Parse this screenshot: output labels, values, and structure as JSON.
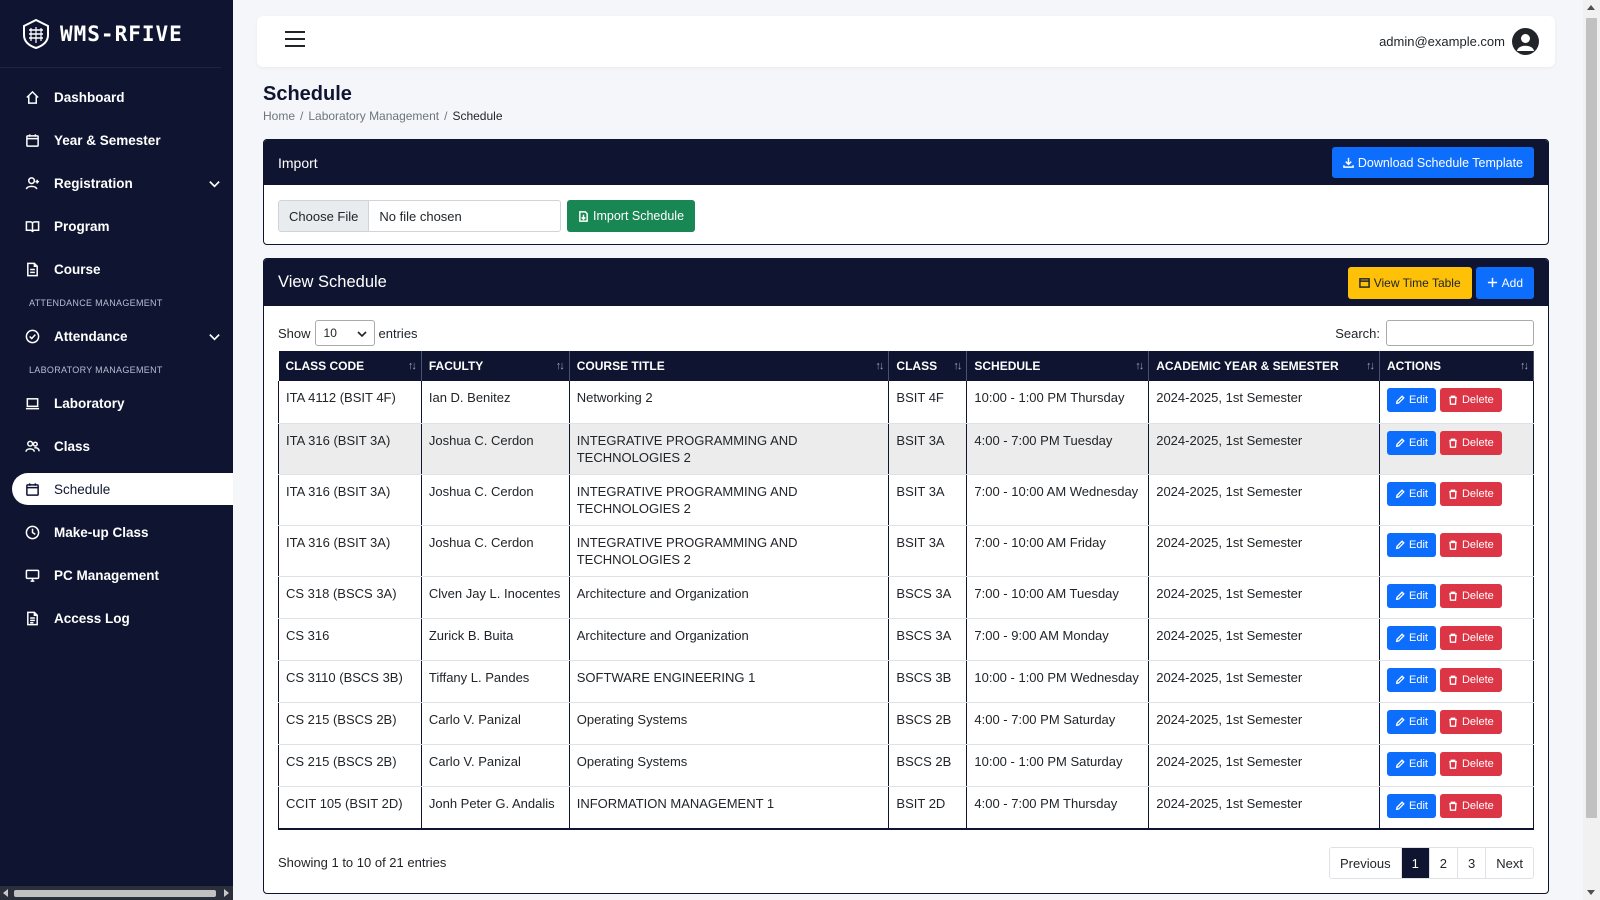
{
  "brand": {
    "name": "WMS-RFIVE"
  },
  "sidebar": {
    "items": [
      {
        "label": "Dashboard",
        "icon": "home-icon"
      },
      {
        "label": "Year & Semester",
        "icon": "calendar-icon"
      },
      {
        "label": "Registration",
        "icon": "user-plus-icon",
        "expandable": true
      },
      {
        "label": "Program",
        "icon": "book-open-icon"
      },
      {
        "label": "Course",
        "icon": "file-icon"
      }
    ],
    "section_attendance": "ATTENDANCE MANAGEMENT",
    "attendance_items": [
      {
        "label": "Attendance",
        "icon": "check-circle-icon",
        "expandable": true
      }
    ],
    "section_laboratory": "LABORATORY MANAGEMENT",
    "lab_items": [
      {
        "label": "Laboratory",
        "icon": "laptop-icon"
      },
      {
        "label": "Class",
        "icon": "users-icon"
      },
      {
        "label": "Schedule",
        "icon": "calendar-icon",
        "active": true
      },
      {
        "label": "Make-up Class",
        "icon": "clock-icon"
      },
      {
        "label": "PC Management",
        "icon": "monitor-icon"
      },
      {
        "label": "Access Log",
        "icon": "file-text-icon"
      }
    ]
  },
  "topbar": {
    "user_email": "admin@example.com"
  },
  "page": {
    "title": "Schedule",
    "breadcrumb": [
      "Home",
      "Laboratory Management",
      "Schedule"
    ]
  },
  "import_card": {
    "title": "Import",
    "download_label": "Download Schedule Template",
    "choose_label": "Choose File",
    "no_file": "No file chosen",
    "import_label": "Import Schedule"
  },
  "view_card": {
    "title": "View Schedule",
    "timetable_label": "View Time Table",
    "add_label": "Add",
    "show_label": "Show",
    "entries_value": "10",
    "entries_label": "entries",
    "search_label": "Search:",
    "columns": [
      "CLASS CODE",
      "FACULTY",
      "COURSE TITLE",
      "CLASS",
      "SCHEDULE",
      "ACADEMIC YEAR & SEMESTER",
      "ACTIONS"
    ],
    "edit_label": "Edit",
    "delete_label": "Delete",
    "rows": [
      [
        "ITA 4112 (BSIT 4F)",
        "Ian D. Benitez",
        "Networking 2",
        "BSIT 4F",
        "10:00 - 1:00 PM Thursday",
        "2024-2025, 1st Semester"
      ],
      [
        "ITA 316 (BSIT 3A)",
        "Joshua C. Cerdon",
        "INTEGRATIVE PROGRAMMING AND TECHNOLOGIES 2",
        "BSIT 3A",
        "4:00 - 7:00 PM Tuesday",
        "2024-2025, 1st Semester"
      ],
      [
        "ITA 316 (BSIT 3A)",
        "Joshua C. Cerdon",
        "INTEGRATIVE PROGRAMMING AND TECHNOLOGIES 2",
        "BSIT 3A",
        "7:00 - 10:00 AM Wednesday",
        "2024-2025, 1st Semester"
      ],
      [
        "ITA 316 (BSIT 3A)",
        "Joshua C. Cerdon",
        "INTEGRATIVE PROGRAMMING AND TECHNOLOGIES 2",
        "BSIT 3A",
        "7:00 - 10:00 AM Friday",
        "2024-2025, 1st Semester"
      ],
      [
        "CS 318 (BSCS 3A)",
        "Clven Jay L. Inocentes",
        "Architecture and Organization",
        "BSCS 3A",
        "7:00 - 10:00 AM Tuesday",
        "2024-2025, 1st Semester"
      ],
      [
        "CS 316",
        "Zurick B. Buita",
        "Architecture and Organization",
        "BSCS 3A",
        "7:00 - 9:00 AM Monday",
        "2024-2025, 1st Semester"
      ],
      [
        "CS 3110 (BSCS 3B)",
        "Tiffany L. Pandes",
        "SOFTWARE ENGINEERING 1",
        "BSCS 3B",
        "10:00 - 1:00 PM Wednesday",
        "2024-2025, 1st Semester"
      ],
      [
        "CS 215 (BSCS 2B)",
        "Carlo V. Panizal",
        "Operating Systems",
        "BSCS 2B",
        "4:00 - 7:00 PM Saturday",
        "2024-2025, 1st Semester"
      ],
      [
        "CS 215 (BSCS 2B)",
        "Carlo V. Panizal",
        "Operating Systems",
        "BSCS 2B",
        "10:00 - 1:00 PM Saturday",
        "2024-2025, 1st Semester"
      ],
      [
        "CCIT 105 (BSIT 2D)",
        "Jonh Peter G. Andalis",
        "INFORMATION MANAGEMENT 1",
        "BSIT 2D",
        "4:00 - 7:00 PM Thursday",
        "2024-2025, 1st Semester"
      ]
    ],
    "info": "Showing 1 to 10 of 21 entries",
    "pagination": [
      "Previous",
      "1",
      "2",
      "3",
      "Next"
    ],
    "active_page": "1"
  }
}
